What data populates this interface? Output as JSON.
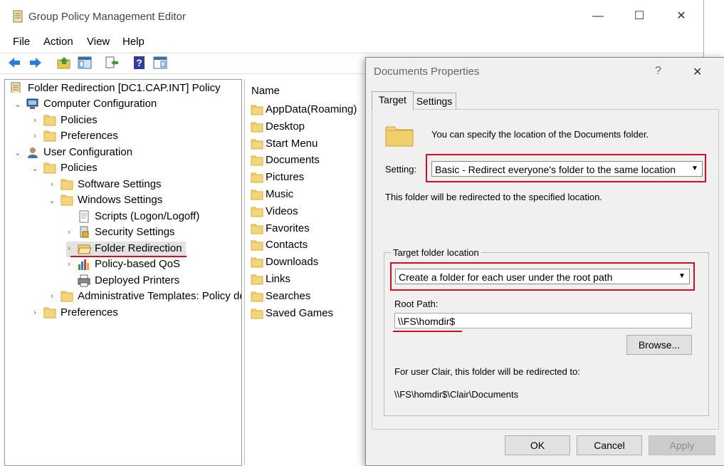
{
  "window": {
    "title": "Group Policy Management Editor",
    "minimize": "—",
    "maximize": "☐",
    "close": "✕"
  },
  "menu": [
    "File",
    "Action",
    "View",
    "Help"
  ],
  "tree": {
    "root": "Folder Redirection [DC1.CAP.INT] Policy",
    "items": [
      {
        "label": "Computer Configuration",
        "indent": 1,
        "expander": "⌄",
        "icon": "computer-icon"
      },
      {
        "label": "Policies",
        "indent": 2,
        "expander": "›",
        "icon": "folder-icon"
      },
      {
        "label": "Preferences",
        "indent": 2,
        "expander": "›",
        "icon": "folder-icon"
      },
      {
        "label": "User Configuration",
        "indent": 1,
        "expander": "⌄",
        "icon": "user-icon"
      },
      {
        "label": "Policies",
        "indent": 2,
        "expander": "⌄",
        "icon": "folder-icon"
      },
      {
        "label": "Software Settings",
        "indent": 3,
        "expander": "›",
        "icon": "folder-icon"
      },
      {
        "label": "Windows Settings",
        "indent": 3,
        "expander": "⌄",
        "icon": "folder-icon"
      },
      {
        "label": "Scripts (Logon/Logoff)",
        "indent": 4,
        "expander": "",
        "icon": "script-icon"
      },
      {
        "label": "Security Settings",
        "indent": 4,
        "expander": "›",
        "icon": "security-icon"
      },
      {
        "label": "Folder Redirection",
        "indent": 4,
        "expander": "›",
        "icon": "folder-open-icon"
      },
      {
        "label": "Policy-based QoS",
        "indent": 4,
        "expander": "›",
        "icon": "chart-icon"
      },
      {
        "label": "Deployed Printers",
        "indent": 4,
        "expander": "",
        "icon": "printer-icon"
      },
      {
        "label": "Administrative Templates: Policy de",
        "indent": 3,
        "expander": "›",
        "icon": "folder-icon"
      },
      {
        "label": "Preferences",
        "indent": 2,
        "expander": "›",
        "icon": "folder-icon"
      }
    ]
  },
  "list": {
    "header": "Name",
    "items": [
      "AppData(Roaming)",
      "Desktop",
      "Start Menu",
      "Documents",
      "Pictures",
      "Music",
      "Videos",
      "Favorites",
      "Contacts",
      "Downloads",
      "Links",
      "Searches",
      "Saved Games"
    ]
  },
  "dialog": {
    "title": "Documents Properties",
    "help": "?",
    "close": "✕",
    "tabs": [
      "Target",
      "Settings"
    ],
    "description": "You can specify the location of the Documents folder.",
    "setting_label": "Setting:",
    "setting_value": "Basic - Redirect everyone's folder to the same location",
    "redirect_note": "This folder will be redirected to the specified location.",
    "group_title": "Target folder location",
    "target_value": "Create a folder for each user under the root path",
    "root_path_label": "Root Path:",
    "root_path_value": "\\\\FS\\homdir$",
    "browse": "Browse...",
    "user_note": "For user Clair, this folder will be redirected to:",
    "resolved_path": "\\\\FS\\homdir$\\Clair\\Documents",
    "ok": "OK",
    "cancel": "Cancel",
    "apply": "Apply"
  },
  "colors": {
    "highlight": "#d01020",
    "folder": "#f5d57a",
    "dialog_bg": "#f0f0f0"
  }
}
